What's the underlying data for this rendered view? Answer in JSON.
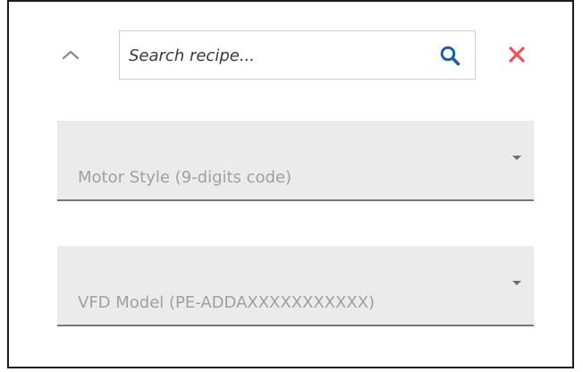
{
  "search": {
    "placeholder": "Search recipe...",
    "value": ""
  },
  "icons": {
    "collapse": "chevron-up-icon",
    "search": "search-icon",
    "close": "close-icon"
  },
  "colors": {
    "search_icon": "#1f5fa8",
    "close_icon": "#f0505a",
    "chevron": "#8a8a8a",
    "dropdown_bg": "#ebebeb",
    "dropdown_text": "#a0a0a0"
  },
  "dropdowns": {
    "motor_style": {
      "label": "Motor Style (9-digits code)"
    },
    "vfd_model": {
      "label": "VFD Model (PE-ADDAXXXXXXXXXXX)"
    }
  }
}
